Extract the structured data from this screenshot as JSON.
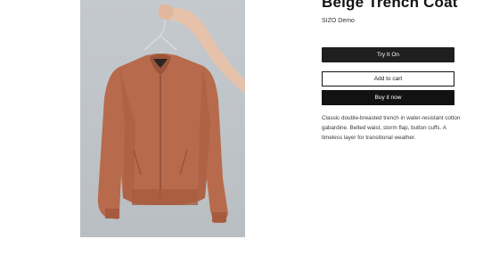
{
  "product": {
    "title": "Beige Trench Coat",
    "vendor": "SIZO Demo",
    "description": "Classic double-breasted trench in water-resistant cotton gabardine. Belted waist, storm flap, button cuffs. A timeless layer for transitional weather."
  },
  "actions": {
    "try_on_label": "Try It On",
    "add_to_cart_label": "Add to cart",
    "buy_now_label": "Buy it now"
  },
  "media": {
    "icon": "product-photo-jacket-on-hanger"
  },
  "colors": {
    "primary_button": "#1f1f1f",
    "buy_button": "#121212",
    "jacket": "#b86a4c"
  }
}
